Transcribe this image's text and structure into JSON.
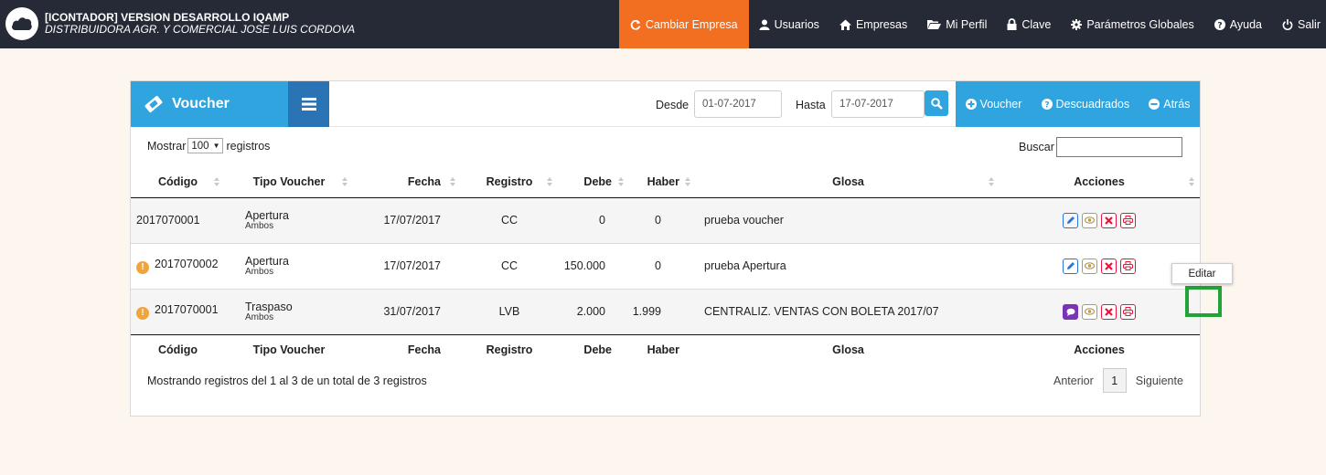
{
  "app": {
    "title": "[ICONTADOR] VERSION DESARROLLO IQAMP",
    "company": "DISTRIBUIDORA AGR. Y COMERCIAL JOSE LUIS CORDOVA"
  },
  "nav": {
    "change_company": "Cambiar Empresa",
    "users": "Usuarios",
    "companies": "Empresas",
    "profile": "Mi Perfil",
    "password": "Clave",
    "global_params": "Parámetros Globales",
    "help": "Ayuda",
    "logout": "Salir"
  },
  "panel": {
    "title": "Voucher",
    "from_label": "Desde",
    "from_value": "01-07-2017",
    "to_label": "Hasta",
    "to_value": "17-07-2017",
    "actions": {
      "new_voucher": "Voucher",
      "unbalanced": "Descuadrados",
      "back": "Atrás"
    }
  },
  "table_controls": {
    "show_label": "Mostrar",
    "page_size": "100",
    "records_label": "registros",
    "search_label": "Buscar",
    "search_value": ""
  },
  "table": {
    "headers": [
      "Código",
      "Tipo Voucher",
      "Fecha",
      "Registro",
      "Debe",
      "Haber",
      "Glosa",
      "Acciones"
    ],
    "rows": [
      {
        "codigo": "2017070001",
        "tipo": "Apertura",
        "tipo_sub": "Ambos",
        "fecha": "17/07/2017",
        "registro": "CC",
        "debe": "0",
        "haber": "0",
        "glosa": "prueba voucher",
        "warning": false,
        "first_action": "edit"
      },
      {
        "codigo": "2017070002",
        "tipo": "Apertura",
        "tipo_sub": "Ambos",
        "fecha": "17/07/2017",
        "registro": "CC",
        "debe": "150.000",
        "haber": "0",
        "glosa": "prueba Apertura",
        "warning": true,
        "first_action": "edit"
      },
      {
        "codigo": "2017070001",
        "tipo": "Traspaso",
        "tipo_sub": "Ambos",
        "fecha": "31/07/2017",
        "registro": "LVB",
        "debe": "2.000",
        "haber": "1.999",
        "glosa": "CENTRALIZ. VENTAS CON BOLETA 2017/07",
        "warning": true,
        "first_action": "comment"
      }
    ],
    "tooltip": "Editar"
  },
  "footer": {
    "info": "Mostrando registros del 1 al 3 de un total de 3 registros",
    "prev": "Anterior",
    "page": "1",
    "next": "Siguiente"
  },
  "colors": {
    "topbar": "#262a36",
    "accent_orange": "#f26f21",
    "panel_blue": "#2fa4de",
    "menu_blue": "#2a74b5",
    "highlight_green": "#21a337",
    "delete_red": "#e3173c"
  },
  "icons": {
    "logo": "cloud-icon",
    "change_company": "refresh-icon",
    "users": "user-icon",
    "companies": "home-icon",
    "profile": "folder-open-icon",
    "password": "lock-icon",
    "global_params": "gear-icon",
    "help": "question-circle-icon",
    "logout": "power-icon",
    "panel_title": "ticket-icon",
    "menu": "hamburger-icon",
    "search": "search-icon",
    "warning": "exclamation-circle-icon",
    "edit": "pencil-icon",
    "view": "eye-icon",
    "delete": "times-icon",
    "print": "print-icon",
    "comment": "comment-icon"
  }
}
